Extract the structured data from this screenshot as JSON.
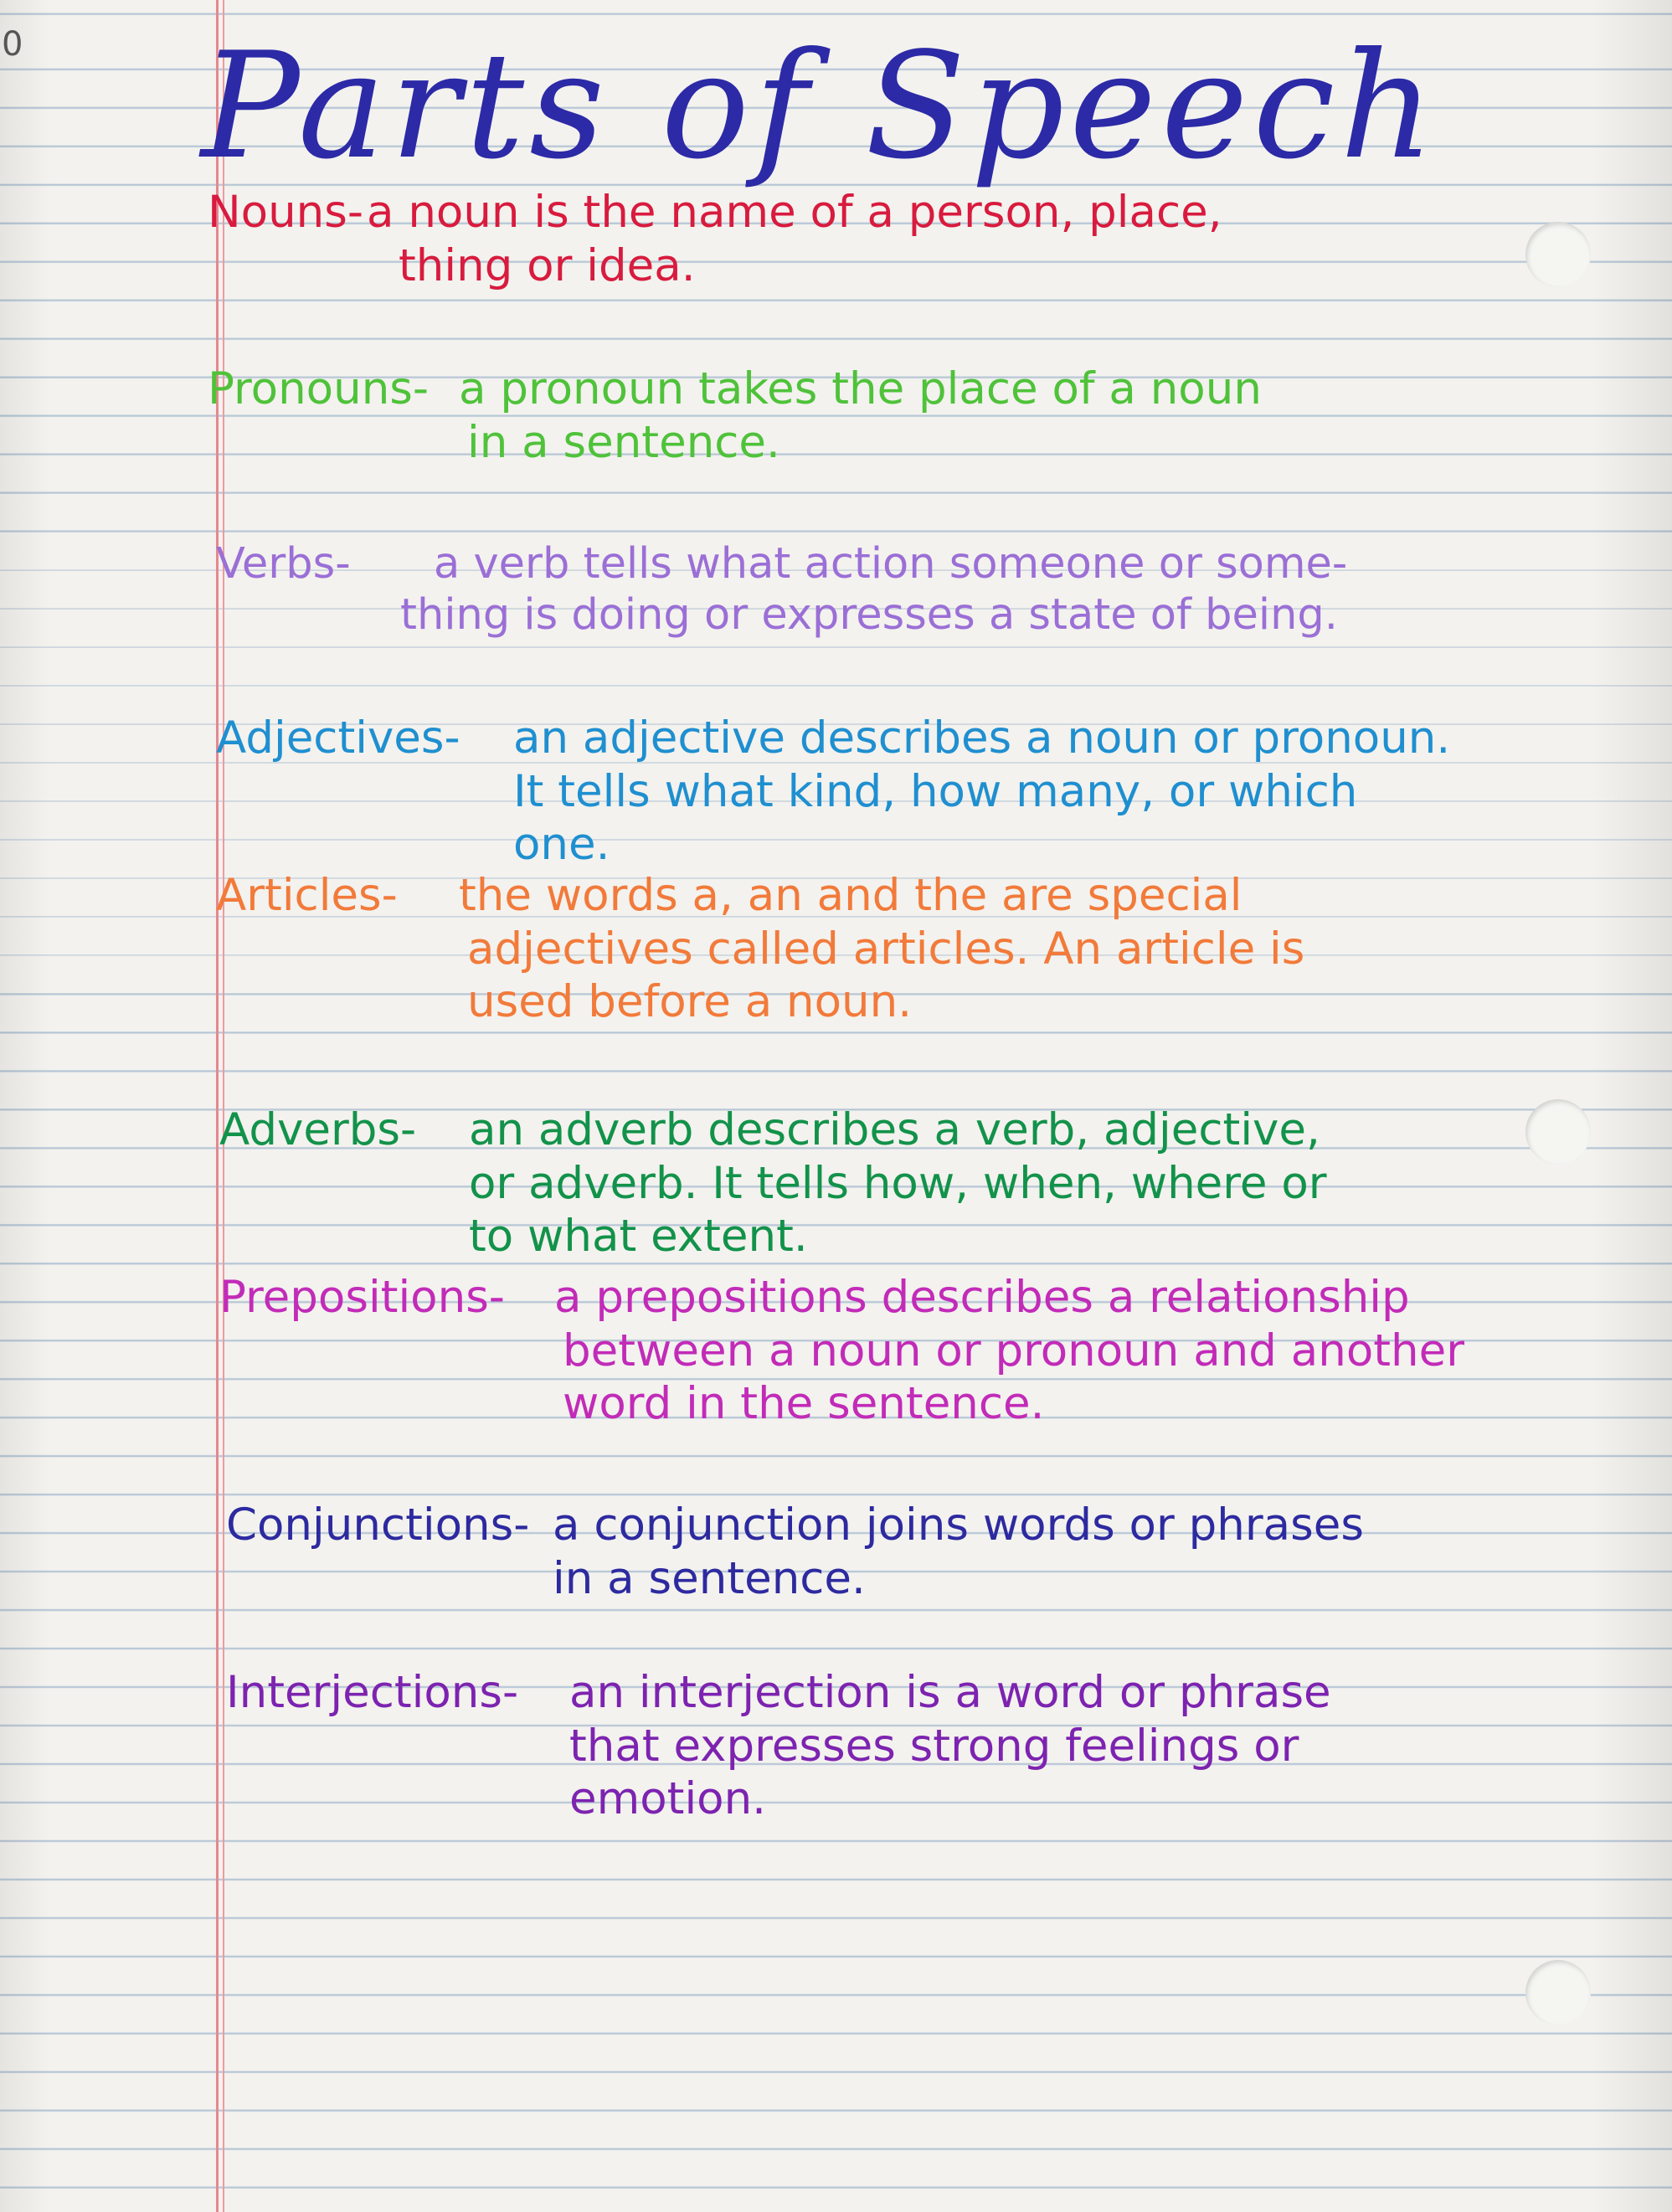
{
  "page": {
    "corner_mark": "0",
    "title": "Parts of Speech"
  },
  "colors": {
    "title": "#2c2aa6",
    "nouns": "#d81b3e",
    "pronouns": "#4fc23a",
    "verbs": "#9b6fd6",
    "adjectives": "#1f8fd0",
    "articles": "#f27a3a",
    "adverbs": "#12924a",
    "prepositions": "#c22bb8",
    "conjunctions": "#2d2aa0",
    "interjections": "#7d23b0"
  },
  "entries": [
    {
      "term": "Nouns-",
      "lines": [
        "a noun is  the name  of a person, place,",
        "thing or idea."
      ]
    },
    {
      "term": "Pronouns-",
      "lines": [
        "a pronoun takes the place of a noun",
        "in a sentence."
      ]
    },
    {
      "term": "Verbs-",
      "lines": [
        "a verb tells what action someone or some-",
        "thing is doing or expresses a state of being."
      ]
    },
    {
      "term": "Adjectives-",
      "lines": [
        "an adjective describes a noun or pronoun.",
        "It tells what kind, how many, or which",
        "one."
      ]
    },
    {
      "term": "Articles-",
      "lines": [
        "the words a, an and the are special",
        "adjectives called articles. An article is",
        "used before a noun."
      ]
    },
    {
      "term": "Adverbs-",
      "lines": [
        "an adverb describes a verb, adjective,",
        "or adverb. It tells how, when, where or",
        "to what extent."
      ]
    },
    {
      "term": "Prepositions-",
      "lines": [
        "a prepositions describes a relationship",
        "between a noun or pronoun and another",
        "word in the sentence."
      ]
    },
    {
      "term": "Conjunctions-",
      "lines": [
        "a conjunction joins words or phrases",
        "in a sentence."
      ]
    },
    {
      "term": "Interjections-",
      "lines": [
        "an interjection is a word or phrase",
        "that expresses strong feelings or",
        "emotion."
      ]
    }
  ]
}
